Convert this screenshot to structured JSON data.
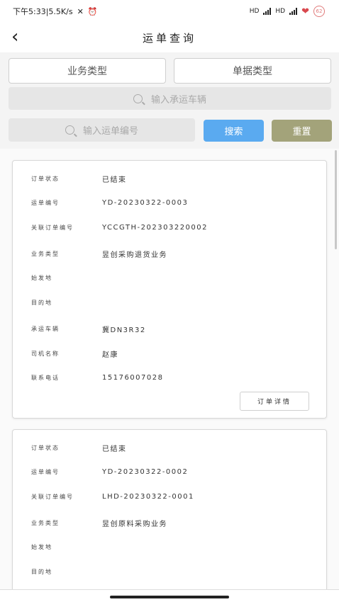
{
  "status_bar": {
    "time_speed": "下午5:33|5.5K/s",
    "signal_label_1": "HD",
    "signal_label_2": "HD",
    "battery": "62"
  },
  "header": {
    "title": "运单查询"
  },
  "filters": {
    "business_type_label": "业务类型",
    "document_type_label": "单据类型",
    "vehicle_placeholder": "输入承运车辆",
    "waybill_placeholder": "输入运单编号",
    "search_label": "搜索",
    "reset_label": "重置",
    "search_color": "#5aaaf0",
    "reset_color": "#a3a37a"
  },
  "cards": [
    {
      "rows": [
        {
          "key": "订单状态",
          "value": "已结束"
        },
        {
          "key": "运单编号",
          "value": "YD-20230322-0003"
        },
        {
          "key": "关联订单编号",
          "value": "YCCGTH-202303220002"
        },
        {
          "key": "业务类型",
          "value": "昱创采购退货业务"
        },
        {
          "key": "始发地",
          "value": ""
        },
        {
          "key": "目的地",
          "value": ""
        },
        {
          "key": "承运车辆",
          "value": "冀DN3R32"
        },
        {
          "key": "司机名称",
          "value": "赵康"
        },
        {
          "key": "联系电话",
          "value": "15176007028"
        }
      ],
      "detail_label": "订单详情"
    },
    {
      "rows": [
        {
          "key": "订单状态",
          "value": "已结束"
        },
        {
          "key": "运单编号",
          "value": "YD-20230322-0002"
        },
        {
          "key": "关联订单编号",
          "value": "LHD-20230322-0001"
        },
        {
          "key": "业务类型",
          "value": "昱创原料采购业务"
        },
        {
          "key": "始发地",
          "value": ""
        },
        {
          "key": "目的地",
          "value": ""
        }
      ]
    }
  ]
}
